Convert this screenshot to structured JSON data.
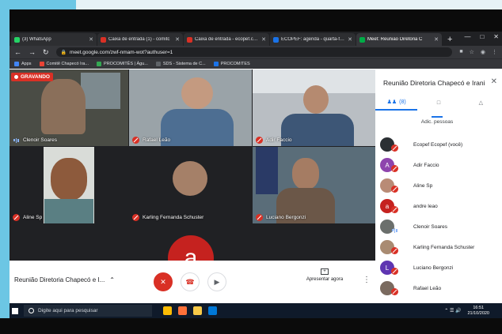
{
  "browser": {
    "tabs": [
      {
        "title": "(3) WhatsApp",
        "color": "#25d366",
        "active": false
      },
      {
        "title": "Caixa de entrada (1) - comitc",
        "color": "#d93025",
        "active": false
      },
      {
        "title": "Caixa de entrada - ecopef.com",
        "color": "#d93025",
        "active": false
      },
      {
        "title": "ECOPEF: agenda - quarta-feira",
        "color": "#1a73e8",
        "active": false
      },
      {
        "title": "Meet: Reunião Diretoria C",
        "color": "#00ac47",
        "active": true
      }
    ],
    "url": "meet.google.com/zwf-nmam-wot?authuser=1",
    "bookmarks": [
      {
        "label": "Apps",
        "color": "#4285f4"
      },
      {
        "label": "Comitê Chapecó Ira...",
        "color": "#ea4335"
      },
      {
        "label": "PROCOMITÊS | Águ...",
        "color": "#34a853"
      },
      {
        "label": "SDS - Sistema de C...",
        "color": "#5f6368"
      },
      {
        "label": "PROCOMITES",
        "color": "#1a73e8"
      }
    ]
  },
  "meet": {
    "recording_label": "GRAVANDO",
    "participants_tiles": [
      {
        "name": "Clenoir Soares",
        "mic": "on",
        "bg": "#3b3e3a"
      },
      {
        "name": "Rafael Leão",
        "mic": "off",
        "bg": "#9aa3a8"
      },
      {
        "name": "Adir Faccio",
        "mic": "off",
        "bg": "#b9bec3"
      },
      {
        "name": "Aline Sp",
        "mic": "off",
        "bg": "#202124"
      },
      {
        "name": "Karling Fernanda Schuster",
        "mic": "off",
        "bg": "#202124"
      },
      {
        "name": "Luciano Bergonzi",
        "mic": "off",
        "bg": "#5a6d79"
      }
    ],
    "bottom_avatar_letter": "a",
    "meeting_name": "Reunião Diretoria Chapecó e I...",
    "present_label": "Apresentar agora"
  },
  "panel": {
    "title": "Reunião Diretoria Chapecó e Irani",
    "people_count": "(8)",
    "add_people_label": "Adic. pessoas",
    "people": [
      {
        "name": "Ecopef Ecopef (você)",
        "avatar_letter": "",
        "avatar_color": "#2b2f33",
        "mic": "off"
      },
      {
        "name": "Adir Faccio",
        "avatar_letter": "A",
        "avatar_color": "#8e44ad",
        "mic": "off"
      },
      {
        "name": "Aline Sp",
        "avatar_letter": "",
        "avatar_color": "#b98b76",
        "mic": "off"
      },
      {
        "name": "andre leao",
        "avatar_letter": "a",
        "avatar_color": "#c5221f",
        "mic": "off"
      },
      {
        "name": "Clenoir Soares",
        "avatar_letter": "",
        "avatar_color": "#6b6f6c",
        "mic": "on"
      },
      {
        "name": "Karling Fernanda Schuster",
        "avatar_letter": "",
        "avatar_color": "#a98b72",
        "mic": "off"
      },
      {
        "name": "Luciano Bergonzi",
        "avatar_letter": "L",
        "avatar_color": "#5e35b1",
        "mic": "off"
      },
      {
        "name": "Rafael Leão",
        "avatar_letter": "",
        "avatar_color": "#7a6a5f",
        "mic": "off"
      }
    ]
  },
  "taskbar": {
    "search_placeholder": "Digite aqui para pesquisar",
    "time": "16:51",
    "date": "21/10/2020",
    "apps": [
      {
        "name": "chrome",
        "color": "#fbbc05"
      },
      {
        "name": "firefox",
        "color": "#ff7139"
      },
      {
        "name": "file-explorer",
        "color": "#f7c948"
      },
      {
        "name": "edge",
        "color": "#0078d7"
      }
    ]
  }
}
